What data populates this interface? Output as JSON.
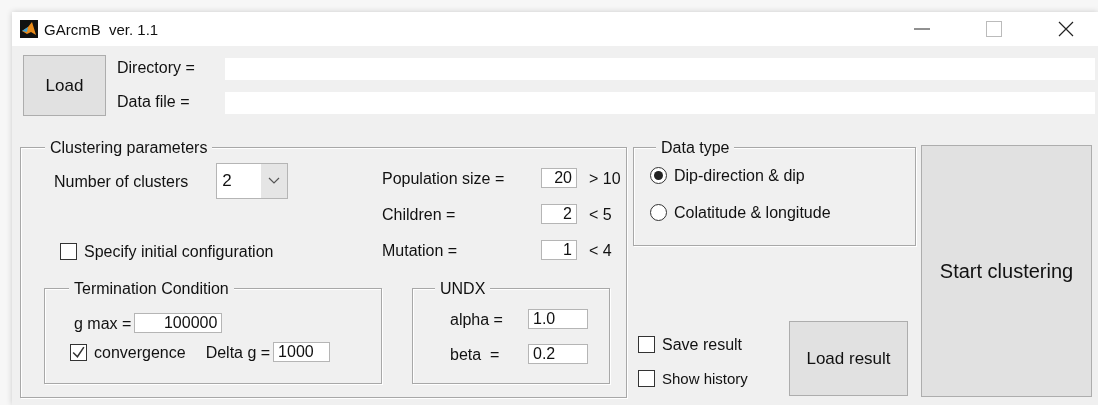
{
  "window": {
    "title": "GArcmB  ver. 1.1"
  },
  "file": {
    "load_button": "Load",
    "directory_label": "Directory =",
    "data_file_label": "Data file ="
  },
  "clustering_parameters": {
    "title": "Clustering parameters",
    "number_of_clusters": {
      "label": "Number of clusters",
      "value": "2"
    },
    "params": [
      {
        "label": "Population size =",
        "value": "20",
        "hint": "> 10"
      },
      {
        "label": "Children =",
        "value": "2",
        "hint": "< 5"
      },
      {
        "label": "Mutation =",
        "value": "1",
        "hint": "< 4"
      }
    ],
    "specify_initial": {
      "label": "Specify initial configuration",
      "checked": false
    },
    "termination": {
      "title": "Termination Condition",
      "g_max": {
        "label": "g max =",
        "value": "100000"
      },
      "convergence": {
        "label": "convergence",
        "checked": true
      },
      "delta_g": {
        "label": "Delta g =",
        "value": "1000"
      }
    },
    "undx": {
      "title": "UNDX",
      "fields": [
        {
          "label": "alpha =",
          "value": "1.0"
        },
        {
          "label": "beta  =",
          "value": "0.2"
        }
      ]
    }
  },
  "data_type": {
    "title": "Data type",
    "options": [
      {
        "label": "Dip-direction & dip",
        "selected": true
      },
      {
        "label": "Colatitude & longitude",
        "selected": false
      }
    ]
  },
  "save_result": {
    "label": "Save result",
    "checked": false
  },
  "show_history": {
    "label": "Show history",
    "checked": false
  },
  "load_result_button": "Load result",
  "start_button": "Start clustering"
}
